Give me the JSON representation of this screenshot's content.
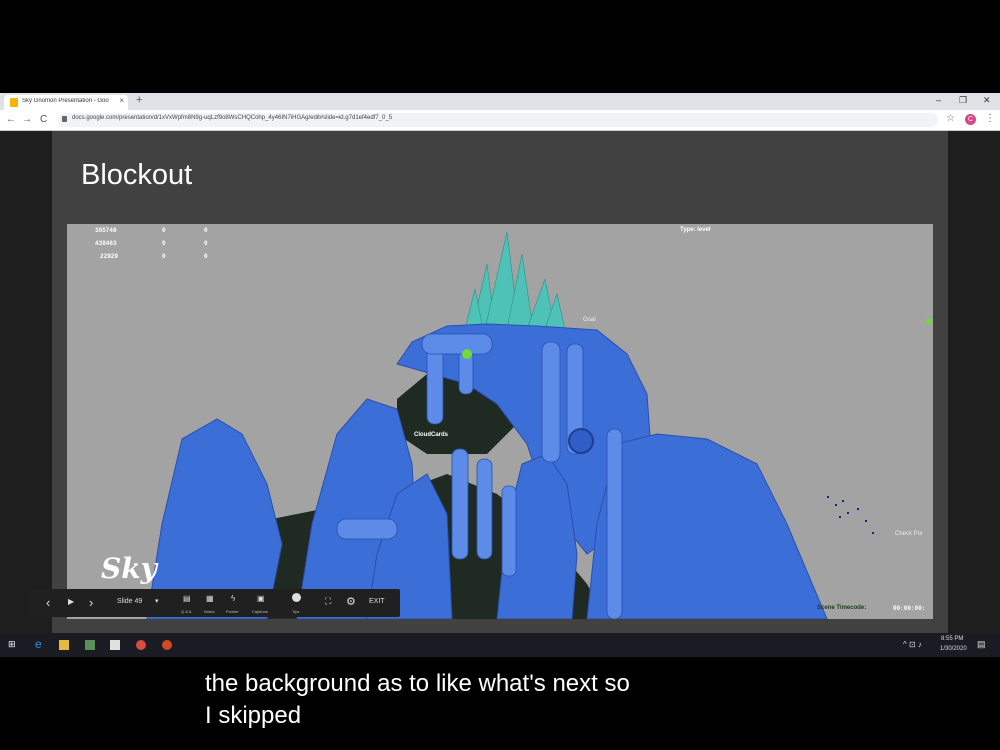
{
  "browser": {
    "tab_title": "Sky Gnomon Presentation - Goo",
    "tab_close": "×",
    "new_tab": "+",
    "url": "docs.google.com/presentation/d/1xVxWpfm8N9g-uqLzf9o8WsCHQCohp_4y46IN7iHGAg/edit#slide=id.g7d1ef4edf7_0_5",
    "profile_initial": "C",
    "back": "←",
    "forward": "→",
    "reload": "C",
    "star": "☆",
    "menu": "⋮",
    "minimize": "–",
    "restore": "❐",
    "close": "✕"
  },
  "slide": {
    "title": "Blockout",
    "screenshot": {
      "stats": [
        [
          "365748",
          "0",
          "0"
        ],
        [
          "438463",
          "0",
          "0"
        ],
        [
          "22929",
          "0",
          "0"
        ]
      ],
      "type_label": "Type:",
      "type_value": "level",
      "labels": {
        "goal": "Goal",
        "cloud_cards": "CloudCards",
        "checkpoint": "Check Poi",
        "scene_timecode_label": "Scene Timecode:",
        "scene_timecode_value": "00:00:00:"
      },
      "logo": "Sky"
    }
  },
  "present_controls": {
    "slide_label": "Slide 49",
    "qa": "Q & A",
    "notes": "Notes",
    "pointer": "Pointer",
    "captions": "Captions",
    "tips": "Tips",
    "exit": "EXIT",
    "prev": "‹",
    "play": "▶",
    "next": "›"
  },
  "taskbar": {
    "time": "8:55 PM",
    "date": "1/30/2020"
  },
  "caption": {
    "line1": "the background as to like what's next so",
    "line2": "I skipped"
  },
  "colors": {
    "slide_bg": "#414141",
    "scene_gray": "#a3a3a3",
    "terrain_blue": "#3c6ed8",
    "terrain_dark": "#1f2a22",
    "crystal": "#4fc2b8",
    "taskbar": "#1b1b24"
  }
}
